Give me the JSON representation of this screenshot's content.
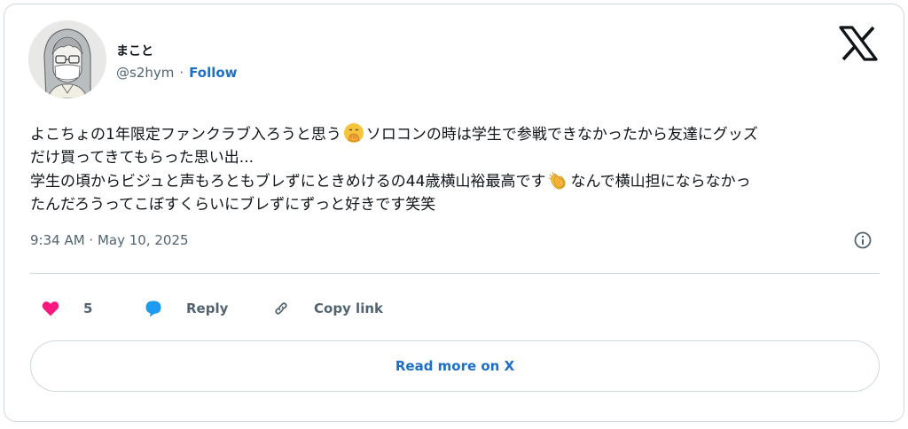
{
  "author": {
    "display_name": "まこと",
    "handle": "@s2hym",
    "separator": "·",
    "follow_label": "Follow"
  },
  "icons": {
    "avatar": "avatar-image",
    "brand": "x-logo-icon",
    "emoji_1": "hand-over-mouth-emoji",
    "emoji_2": "clapping-hands-emoji",
    "info": "info-icon",
    "like": "heart-icon",
    "reply": "speech-bubble-icon",
    "copy": "link-icon"
  },
  "tweet": {
    "line1_before_emoji": "よこちょの1年限定ファンクラブ入ろうと思う",
    "line1_after_emoji": "ソロコンの時は学生で参戦できなかったから友達にグッズ",
    "line2": "だけ買ってきてもらった思い出...",
    "line3_before_emoji": "学生の頃からビジュと声もろともブレずにときめけるの44歳横山裕最高です",
    "line3_after_emoji": "なんで横山担にならなかっ",
    "line4": "たんだろうってこぼすくらいにブレずにずっと好きです笑笑"
  },
  "timestamp": "9:34 AM · May 10, 2025",
  "actions": {
    "like_count": "5",
    "reply_label": "Reply",
    "copy_label": "Copy link"
  },
  "read_more_label": "Read more on X",
  "colors": {
    "link_blue": "#1d6fc7",
    "like_pink": "#f91880",
    "reply_blue": "#1d9bf0",
    "secondary_text": "#536471",
    "border": "#cfd9de"
  }
}
